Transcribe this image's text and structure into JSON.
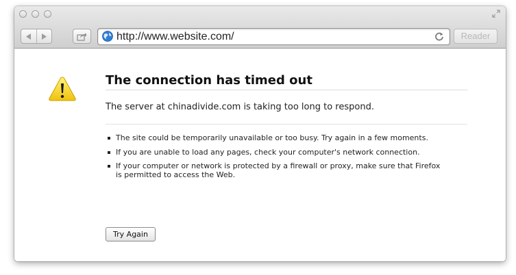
{
  "toolbar": {
    "url": "http://www.website.com/",
    "reader_label": "Reader"
  },
  "error": {
    "title": "The connection has timed out",
    "description": "The server at chinadivide.com is taking too long to respond.",
    "suggestions": [
      "The site could be temporarily unavailable or too busy. Try again in a few moments.",
      "If you are unable to load any pages, check your computer's network connection.",
      "If your computer or network is protected by a firewall or proxy, make sure that Firefox is permitted to access the Web."
    ],
    "try_again_label": "Try Again"
  },
  "colors": {
    "warning_yellow": "#f5d020",
    "globe_blue": "#2f7fd6"
  }
}
